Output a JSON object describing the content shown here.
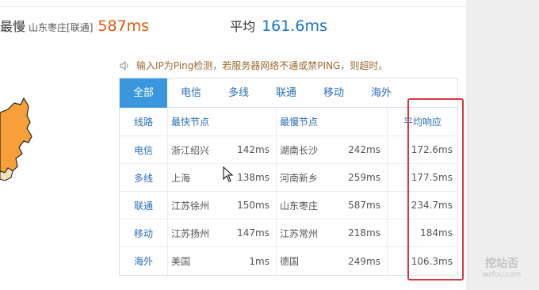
{
  "stats": {
    "slowest_label": "最慢",
    "slowest_region": "山东枣庄[联通]",
    "slowest_value": "587ms",
    "average_label": "平均",
    "average_value": "161.6ms"
  },
  "notice": {
    "icon": "speaker-icon",
    "text": "输入IP为Ping检测，若服务器网络不通或禁PING，则超时。"
  },
  "tabs": [
    {
      "label": "全部",
      "active": true
    },
    {
      "label": "电信",
      "active": false
    },
    {
      "label": "多线",
      "active": false
    },
    {
      "label": "联通",
      "active": false
    },
    {
      "label": "移动",
      "active": false
    },
    {
      "label": "海外",
      "active": false
    }
  ],
  "table": {
    "headers": {
      "line": "线路",
      "fastest": "最快节点",
      "slowest": "最慢节点",
      "average": "平均响应"
    },
    "rows": [
      {
        "line": "电信",
        "fast_node": "浙江绍兴",
        "fast_ms": "142ms",
        "slow_node": "湖南长沙",
        "slow_ms": "242ms",
        "avg": "172.6ms"
      },
      {
        "line": "多线",
        "fast_node": "上海",
        "fast_ms": "138ms",
        "slow_node": "河南新乡",
        "slow_ms": "259ms",
        "avg": "177.5ms"
      },
      {
        "line": "联通",
        "fast_node": "江苏徐州",
        "fast_ms": "150ms",
        "slow_node": "山东枣庄",
        "slow_ms": "587ms",
        "avg": "234.7ms"
      },
      {
        "line": "移动",
        "fast_node": "江苏扬州",
        "fast_ms": "147ms",
        "slow_node": "江苏常州",
        "slow_ms": "218ms",
        "avg": "184ms"
      },
      {
        "line": "海外",
        "fast_node": "美国",
        "fast_ms": "1ms",
        "slow_node": "德国",
        "slow_ms": "249ms",
        "avg": "106.3ms"
      }
    ]
  },
  "watermark": {
    "title": "挖站否",
    "url": "wzfou.com"
  },
  "colors": {
    "accent": "#3a97dd",
    "slow": "#e8590c",
    "avg": "#1a73c9",
    "highlight": "#d9363e",
    "map": "#f7a03a"
  }
}
